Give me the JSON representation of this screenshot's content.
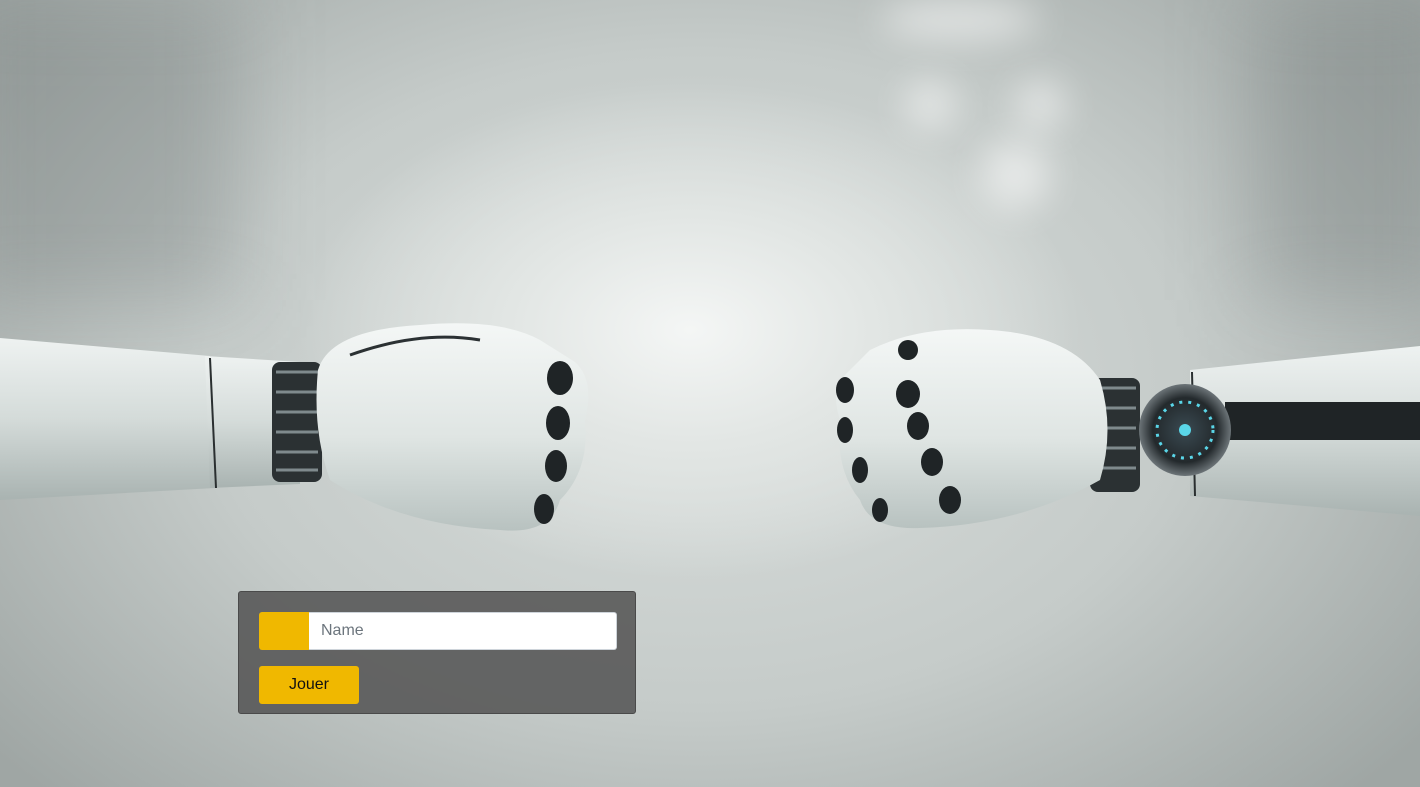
{
  "form": {
    "name_placeholder": "Name",
    "name_value": "",
    "play_label": "Jouer"
  },
  "background": {
    "image": "robot-hands-fist-bump"
  },
  "colors": {
    "accent": "#f0b800",
    "panel": "#5a5a5a"
  }
}
